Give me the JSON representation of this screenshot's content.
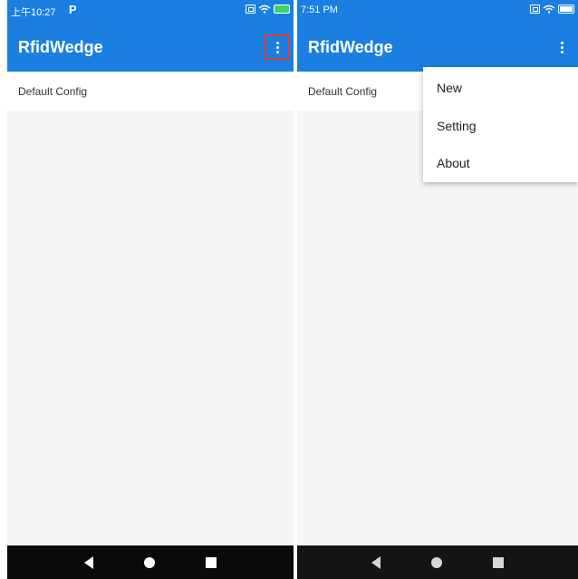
{
  "left_screen": {
    "status": {
      "time": "上午10:27",
      "carrier_glyph": "P"
    },
    "app_bar": {
      "title": "RfidWedge",
      "overflow_icon": "more-vert-icon"
    },
    "list": [
      {
        "label": "Default Config"
      }
    ]
  },
  "right_screen": {
    "status": {
      "time": "7:51 PM"
    },
    "app_bar": {
      "title": "RfidWedge",
      "overflow_icon": "more-vert-icon"
    },
    "list": [
      {
        "label": "Default Config"
      }
    ],
    "menu": [
      {
        "label": "New"
      },
      {
        "label": "Setting"
      },
      {
        "label": "About"
      }
    ]
  },
  "colors": {
    "app_bar": "#1a7fe0",
    "highlight_box": "#d9413c",
    "background": "#f5f5f5",
    "nav_bar": "#0a0a0a"
  },
  "icons": {
    "nav": [
      "back-icon",
      "home-icon",
      "recents-icon"
    ],
    "status": [
      "screen-icon",
      "wifi-icon",
      "battery-icon"
    ]
  }
}
